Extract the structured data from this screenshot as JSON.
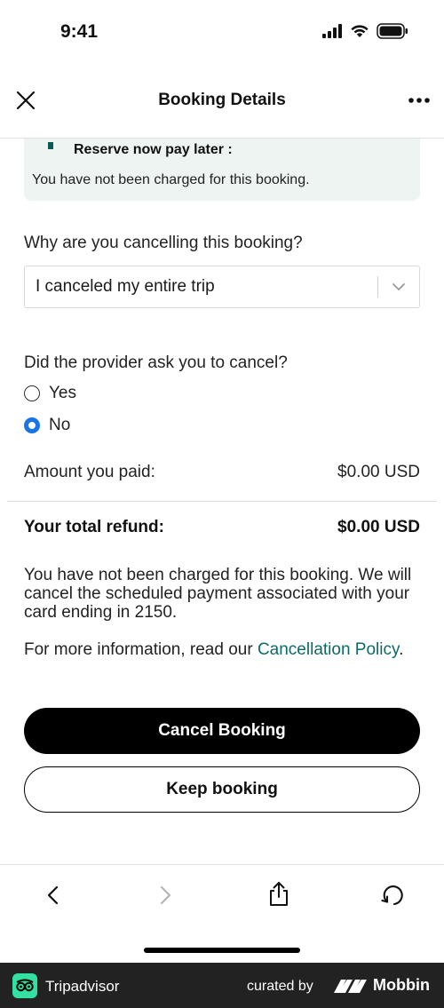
{
  "status_bar": {
    "time": "9:41"
  },
  "header": {
    "title": "Booking Details"
  },
  "notice": {
    "title": "Reserve now pay later :",
    "text": "You have not been charged for this booking."
  },
  "cancel_reason": {
    "question": "Why are you cancelling this booking?",
    "selected": "I canceled my entire trip"
  },
  "provider_question": {
    "question": "Did the provider ask you to cancel?",
    "options": [
      {
        "label": "Yes",
        "selected": false
      },
      {
        "label": "No",
        "selected": true
      }
    ]
  },
  "amounts": {
    "paid_label": "Amount you paid:",
    "paid_value": "$0.00 USD",
    "refund_label": "Your total refund:",
    "refund_value": "$0.00 USD"
  },
  "info": {
    "charge_text": "You have not been charged for this booking. We will cancel the scheduled payment associated with your card ending in 2150.",
    "policy_prefix": "For more information, read our ",
    "policy_link": "Cancellation Policy",
    "policy_suffix": "."
  },
  "buttons": {
    "cancel": "Cancel Booking",
    "keep": "Keep booking"
  },
  "toolbar": {
    "icons": [
      "back-icon",
      "forward-icon",
      "share-icon",
      "refresh-icon"
    ]
  },
  "footer": {
    "app_name": "Tripadvisor",
    "curated_by": "curated by",
    "brand": "Mobbin"
  },
  "colors": {
    "accent_radio": "#1a73e8",
    "link": "#0b6b64",
    "notice_bg": "#edf4f2",
    "primary_button": "#000000"
  }
}
